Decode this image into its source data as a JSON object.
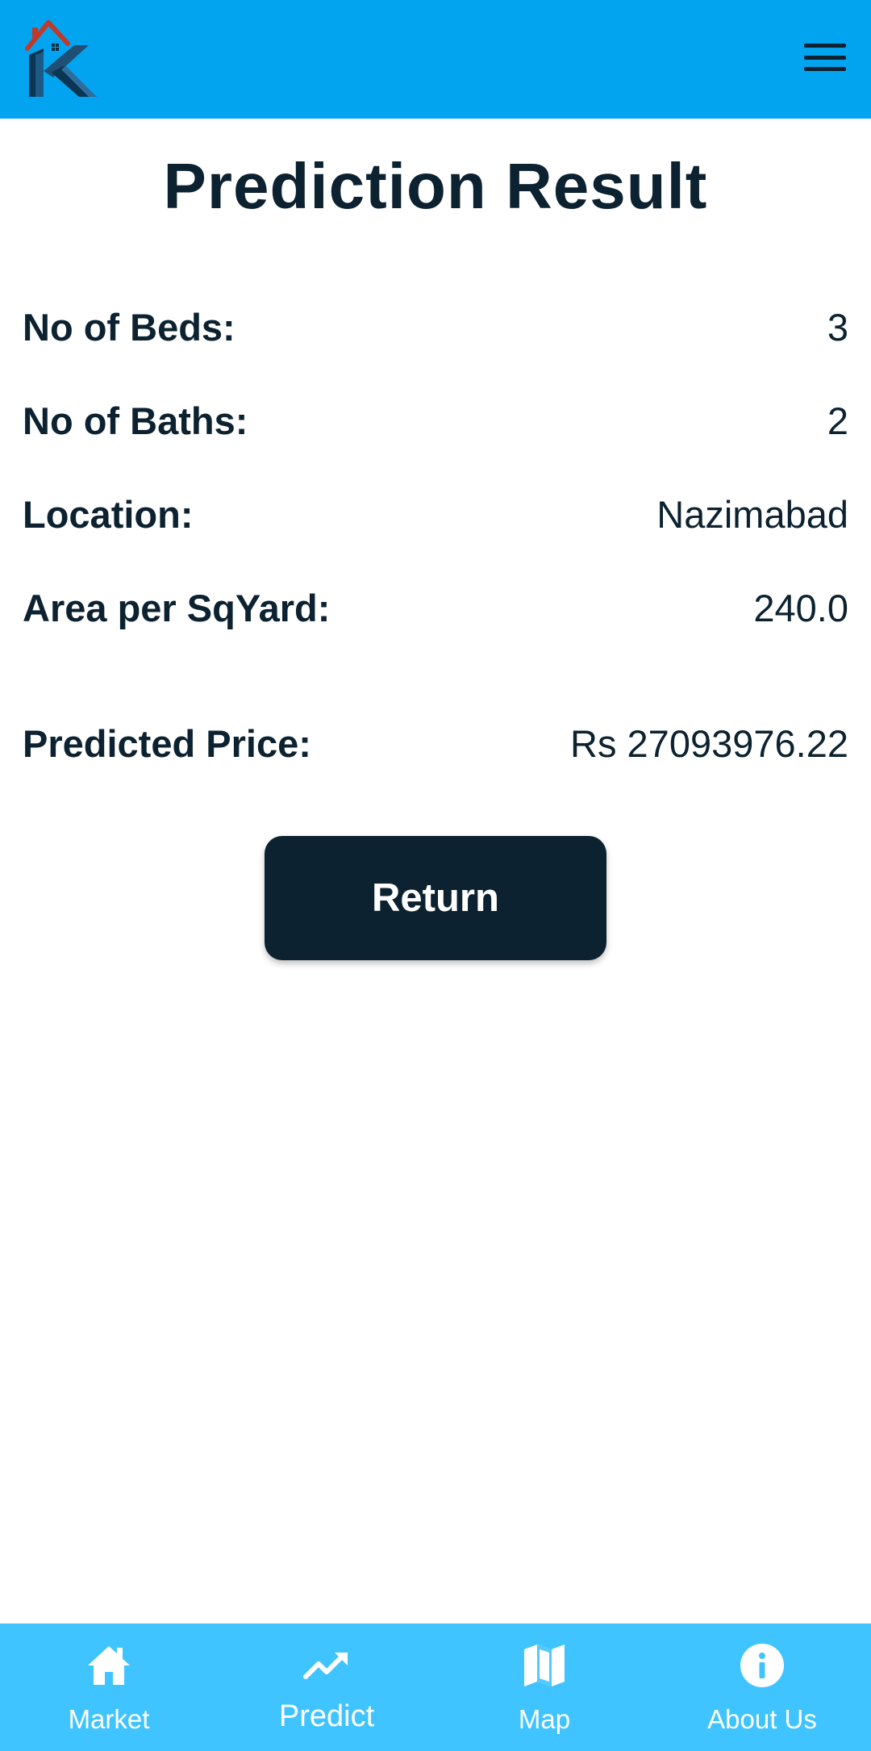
{
  "header": {
    "logo_icon": "k-house-logo-icon",
    "menu_icon": "hamburger-menu-icon"
  },
  "title": "Prediction Result",
  "details": {
    "beds": {
      "label": "No of Beds:",
      "value": "3"
    },
    "baths": {
      "label": "No of Baths:",
      "value": "2"
    },
    "location": {
      "label": "Location:",
      "value": "Nazimabad"
    },
    "area": {
      "label": "Area per SqYard:",
      "value": "240.0"
    },
    "price": {
      "label": "Predicted Price:",
      "value": "Rs 27093976.22"
    }
  },
  "return_label": "Return",
  "bottom_nav": {
    "items": [
      {
        "label": "Market",
        "icon": "home-icon"
      },
      {
        "label": "Predict",
        "icon": "trending-up-icon",
        "active": true
      },
      {
        "label": "Map",
        "icon": "map-icon"
      },
      {
        "label": "About Us",
        "icon": "info-icon"
      }
    ]
  },
  "colors": {
    "app_bar": "#03a4ef",
    "bottom_nav": "#40c4ff",
    "text_dark": "#0c2230",
    "button_bg": "#0c2230"
  }
}
